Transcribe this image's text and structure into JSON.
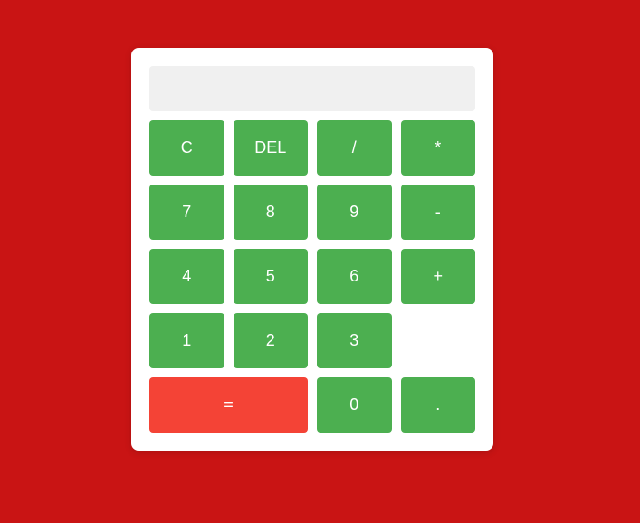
{
  "colors": {
    "background": "#c91414",
    "panel": "#ffffff",
    "display": "#f0f0f0",
    "key": "#4caf50",
    "equals": "#f44336"
  },
  "display": {
    "value": "",
    "placeholder": ""
  },
  "keys": {
    "clear": "C",
    "delete": "DEL",
    "divide": "/",
    "multiply": "*",
    "seven": "7",
    "eight": "8",
    "nine": "9",
    "subtract": "-",
    "four": "4",
    "five": "5",
    "six": "6",
    "add": "+",
    "one": "1",
    "two": "2",
    "three": "3",
    "equals": "=",
    "zero": "0",
    "decimal": "."
  }
}
